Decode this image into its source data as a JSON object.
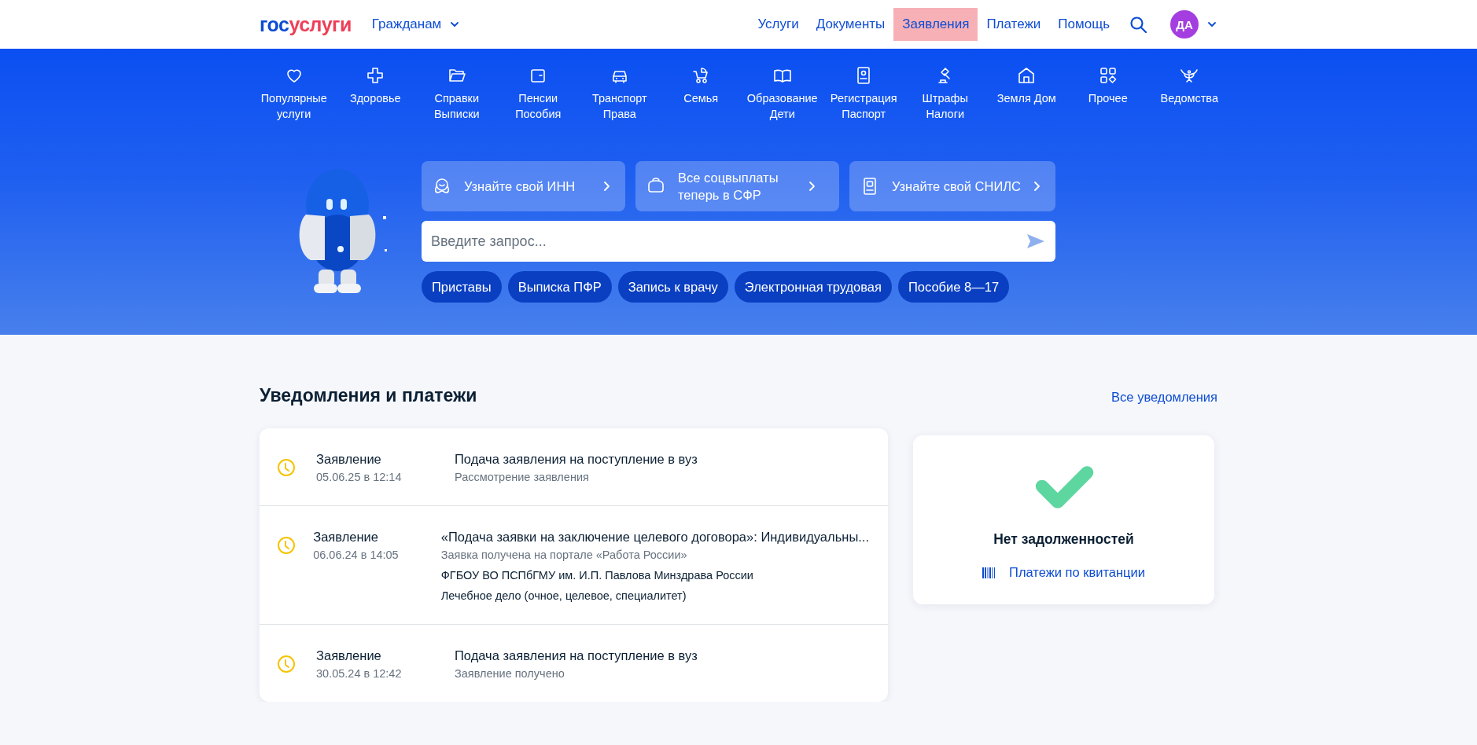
{
  "header": {
    "logo": {
      "prefix": "гос",
      "suffix": "услуги"
    },
    "audience": "Гражданам",
    "nav": [
      {
        "label": "Услуги",
        "selected": false
      },
      {
        "label": "Документы",
        "selected": false
      },
      {
        "label": "Заявления",
        "selected": true
      },
      {
        "label": "Платежи",
        "selected": false
      },
      {
        "label": "Помощь",
        "selected": false
      }
    ],
    "avatar": "ДА"
  },
  "categories": [
    {
      "label": "Популярные\nуслуги"
    },
    {
      "label": "Здоровье"
    },
    {
      "label": "Справки\nВыписки"
    },
    {
      "label": "Пенсии\nПособия"
    },
    {
      "label": "Транспорт\nПрава"
    },
    {
      "label": "Семья"
    },
    {
      "label": "Образование\nДети"
    },
    {
      "label": "Регистрация\nПаспорт"
    },
    {
      "label": "Штрафы\nНалоги"
    },
    {
      "label": "Земля Дом"
    },
    {
      "label": "Прочее"
    },
    {
      "label": "Ведомства"
    }
  ],
  "promos": [
    {
      "label": "Узнайте свой ИНН"
    },
    {
      "label": "Все соцвыплаты теперь в СФР"
    },
    {
      "label": "Узнайте свой СНИЛС"
    }
  ],
  "search": {
    "placeholder": "Введите запрос..."
  },
  "quick_links": [
    "Приставы",
    "Выписка ПФР",
    "Запись к врачу",
    "Электронная трудовая",
    "Пособие 8—17"
  ],
  "notifications": {
    "title": "Уведомления и платежи",
    "all_link": "Все уведомления",
    "items": [
      {
        "type": "Заявление",
        "date": "05.06.25 в 12:14",
        "title": "Подача заявления на поступление в вуз",
        "status": "Рассмотрение заявления"
      },
      {
        "type": "Заявление",
        "date": "06.06.24 в 14:05",
        "title": "«Подача заявки на заключение целевого договора»: Индивидуальны...",
        "status": "Заявка получена на портале «Работа России»",
        "details": [
          "ФГБОУ ВО ПСПбГМУ им. И.П. Павлова Минздрава России",
          "Лечебное дело (очное, целевое, специалитет)"
        ]
      },
      {
        "type": "Заявление",
        "date": "30.05.24 в 12:42",
        "title": "Подача заявления на поступление в вуз",
        "status": "Заявление получено"
      }
    ]
  },
  "debts": {
    "message": "Нет задолженностей",
    "link": "Платежи по квитанции"
  }
}
